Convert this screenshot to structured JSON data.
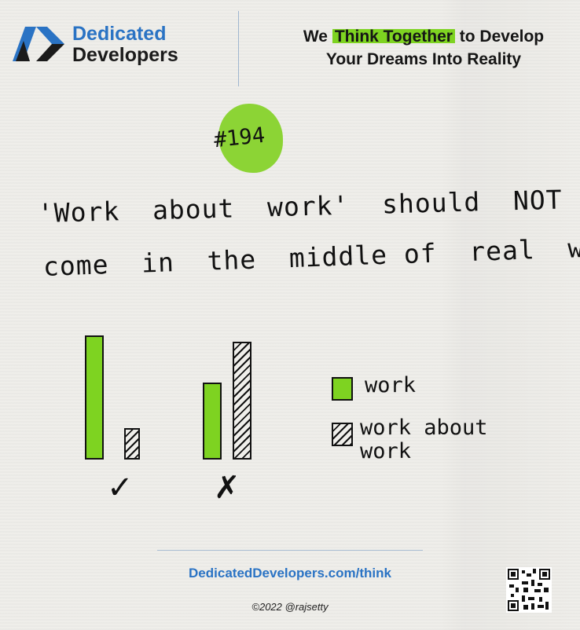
{
  "brand": {
    "line1": "Dedicated",
    "line2": "Developers",
    "logo_icon": "dd-chevron-logo",
    "colors": {
      "blue": "#2a73c4",
      "dark": "#1b1b1b"
    }
  },
  "tagline": {
    "pre": "We ",
    "highlight": "Think Together",
    "post": " to Develop",
    "line2": "Your Dreams Into Reality",
    "highlight_color": "#7ed321"
  },
  "issue": "#194",
  "message": {
    "line1": "'Work  about  work'  should  NOT",
    "line2": "come  in  the  middle of  real  work!"
  },
  "chart_data": {
    "type": "bar",
    "categories": [
      "✓",
      "✗"
    ],
    "series": [
      {
        "name": "work",
        "values": [
          100,
          62
        ]
      },
      {
        "name": "work about work",
        "values": [
          25,
          95
        ]
      }
    ],
    "colors": {
      "work": "#7ed321",
      "work about work": "hatched"
    }
  },
  "legend": [
    {
      "label": "work"
    },
    {
      "label": "work about\nwork"
    }
  ],
  "footer": {
    "url": "DedicatedDevelopers.com/think",
    "copyright": "©2022 @rajsetty",
    "qr_icon": "qr-code-icon"
  }
}
